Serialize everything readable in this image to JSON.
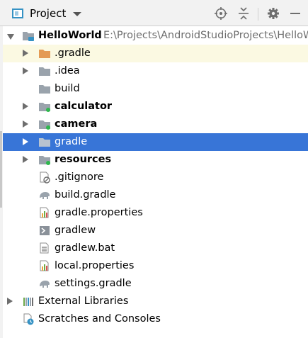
{
  "header": {
    "title": "Project",
    "icons": [
      "project-icon",
      "dropdown-arrow-icon",
      "locate-target-icon",
      "collapse-all-icon",
      "gear-icon",
      "minimize-icon"
    ]
  },
  "colors": {
    "selection": "#3875d7",
    "folder": "#9aa3ac",
    "folder_orange": "#e49b55",
    "module_badge": "#2fb84e",
    "vcs_highlight": "#fbf9e2"
  },
  "tree": {
    "root": {
      "label": "HelloWorld",
      "path": "E:\\Projects\\AndroidStudioProjects\\HelloWorld"
    },
    "items": [
      {
        "label": ".gradle"
      },
      {
        "label": ".idea"
      },
      {
        "label": "build"
      },
      {
        "label": "calculator"
      },
      {
        "label": "camera"
      },
      {
        "label": "gradle"
      },
      {
        "label": "resources"
      },
      {
        "label": ".gitignore"
      },
      {
        "label": "build.gradle"
      },
      {
        "label": "gradle.properties"
      },
      {
        "label": "gradlew"
      },
      {
        "label": "gradlew.bat"
      },
      {
        "label": "local.properties"
      },
      {
        "label": "settings.gradle"
      }
    ],
    "external_libraries": "External Libraries",
    "scratches": "Scratches and Consoles"
  }
}
